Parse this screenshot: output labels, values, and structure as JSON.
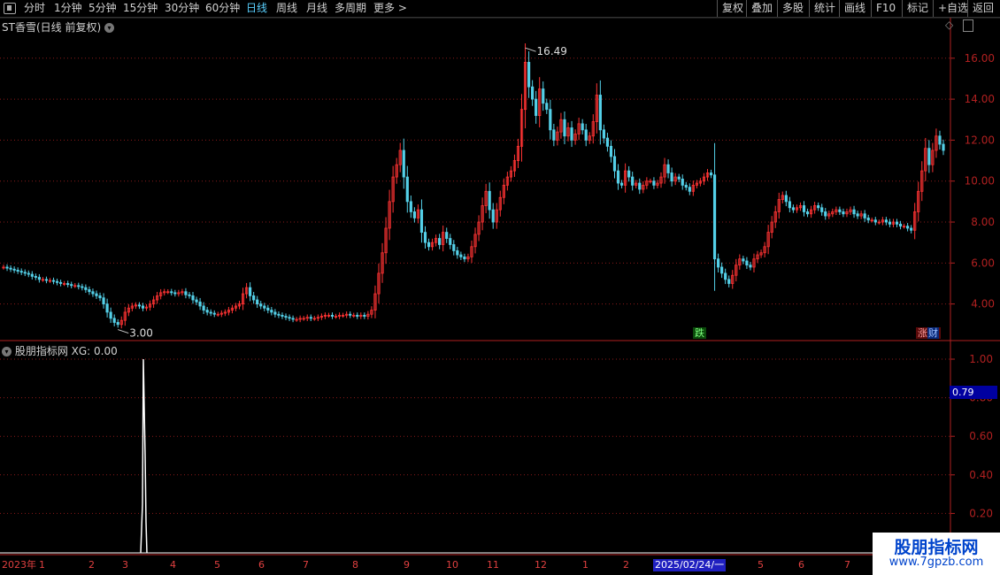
{
  "toolbar": {
    "periods": [
      "分时",
      "1分钟",
      "5分钟",
      "15分钟",
      "30分钟",
      "60分钟",
      "日线",
      "周线",
      "月线",
      "多周期",
      "更多 >"
    ],
    "active_period": "日线",
    "right_buttons": [
      "复权",
      "叠加",
      "多股",
      "统计",
      "画线",
      "F10",
      "标记",
      "+自选",
      "返回"
    ]
  },
  "main_panel": {
    "title": "ST香雪(日线 前复权)",
    "high_label": "16.49",
    "low_label": "3.00",
    "y_ticks": [
      "16.00",
      "14.00",
      "12.00",
      "10.00",
      "8.00",
      "6.00",
      "4.00"
    ],
    "badge_down": "跌",
    "badge_right": "涨"
  },
  "indicator_panel": {
    "title": "股朋指标网 XG: 0.00",
    "y_ticks": [
      "1.00",
      "0.80",
      "0.60",
      "0.40",
      "0.20"
    ],
    "current_value": "0.79"
  },
  "x_axis": {
    "labels": [
      "2023年",
      "1",
      "2",
      "3",
      "4",
      "5",
      "6",
      "7",
      "8",
      "9",
      "10",
      "11",
      "12",
      "1",
      "2",
      "5",
      "6",
      "7"
    ],
    "highlight_date": "2025/02/24/一"
  },
  "watermark": {
    "main": "股朋指标网",
    "sub": "www.7gpzb.com"
  },
  "colors": {
    "up": "#ff3333",
    "down": "#54d0e8",
    "grid": "#8a1a1a",
    "axis": "#b02020"
  },
  "chart_data": {
    "type": "candlestick",
    "ylim": [
      2.3,
      17.2
    ],
    "y_ticks": [
      16,
      14,
      12,
      10,
      8,
      6,
      4
    ],
    "closes": [
      5.8,
      5.75,
      5.7,
      5.65,
      5.6,
      5.55,
      5.5,
      5.45,
      5.35,
      5.3,
      5.2,
      5.2,
      5.15,
      5.15,
      5.1,
      5.05,
      5.0,
      5.0,
      4.95,
      4.9,
      4.9,
      4.85,
      4.8,
      4.7,
      4.6,
      4.5,
      4.4,
      4.3,
      4.0,
      3.6,
      3.3,
      3.1,
      3.0,
      3.2,
      3.6,
      3.8,
      3.9,
      3.95,
      3.9,
      3.8,
      3.85,
      4.0,
      4.2,
      4.4,
      4.55,
      4.6,
      4.6,
      4.55,
      4.5,
      4.55,
      4.6,
      4.45,
      4.4,
      4.2,
      4.1,
      3.9,
      3.7,
      3.6,
      3.55,
      3.5,
      3.5,
      3.55,
      3.6,
      3.7,
      3.8,
      3.9,
      4.0,
      4.5,
      4.8,
      4.4,
      4.2,
      4.0,
      3.9,
      3.8,
      3.7,
      3.6,
      3.5,
      3.45,
      3.4,
      3.35,
      3.3,
      3.25,
      3.25,
      3.3,
      3.3,
      3.35,
      3.3,
      3.3,
      3.35,
      3.4,
      3.45,
      3.45,
      3.4,
      3.4,
      3.45,
      3.45,
      3.5,
      3.45,
      3.45,
      3.4,
      3.45,
      3.4,
      3.5,
      3.7,
      4.5,
      5.5,
      6.5,
      7.7,
      9.0,
      10.2,
      10.8,
      11.5,
      10.2,
      9.0,
      8.5,
      8.2,
      8.6,
      7.5,
      7.0,
      6.8,
      7.0,
      7.2,
      6.9,
      7.5,
      7.2,
      6.9,
      6.6,
      6.4,
      6.3,
      6.2,
      6.3,
      6.8,
      7.4,
      8.0,
      8.8,
      9.5,
      8.6,
      8.0,
      8.6,
      9.2,
      9.8,
      10.2,
      10.5,
      11.0,
      11.7,
      13.5,
      15.8,
      14.6,
      14.0,
      13.2,
      14.5,
      13.8,
      13.5,
      12.5,
      12.0,
      12.4,
      13.0,
      12.2,
      12.6,
      12.0,
      12.3,
      12.8,
      12.5,
      12.0,
      12.2,
      12.9,
      14.2,
      12.5,
      12.1,
      11.7,
      11.2,
      10.5,
      9.9,
      9.8,
      10.5,
      10.2,
      9.8,
      9.9,
      9.6,
      9.8,
      10.0,
      10.0,
      9.8,
      9.9,
      10.2,
      10.8,
      10.4,
      10.0,
      10.2,
      10.1,
      9.8,
      9.7,
      9.5,
      9.8,
      9.9,
      10.0,
      10.2,
      10.4,
      10.3,
      6.2,
      5.8,
      5.5,
      5.2,
      5.0,
      5.4,
      5.9,
      6.2,
      6.1,
      5.9,
      5.8,
      6.2,
      6.4,
      6.5,
      6.8,
      7.5,
      8.0,
      8.5,
      9.1,
      9.3,
      9.0,
      8.7,
      8.6,
      8.7,
      8.8,
      8.5,
      8.4,
      8.6,
      8.8,
      8.7,
      8.5,
      8.3,
      8.4,
      8.5,
      8.6,
      8.5,
      8.4,
      8.5,
      8.6,
      8.4,
      8.3,
      8.4,
      8.2,
      8.1,
      8.1,
      8.0,
      8.0,
      8.1,
      8.0,
      7.9,
      8.0,
      7.9,
      7.8,
      7.8,
      7.7,
      7.6,
      8.5,
      9.5,
      10.5,
      11.6,
      10.8,
      11.5,
      12.2,
      11.8,
      11.5
    ]
  }
}
